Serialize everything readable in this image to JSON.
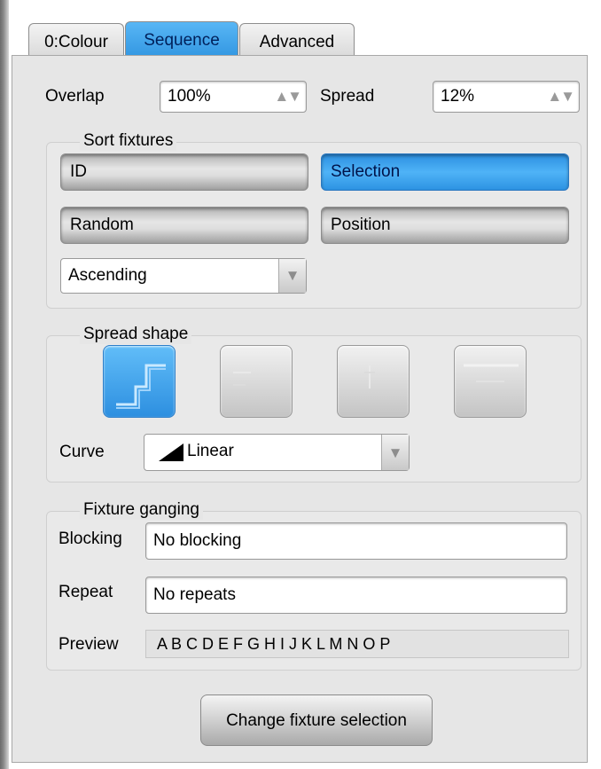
{
  "tabs": [
    {
      "label": "0:Colour",
      "active": false
    },
    {
      "label": "Sequence",
      "active": true
    },
    {
      "label": "Advanced",
      "active": false
    }
  ],
  "overlap": {
    "label": "Overlap",
    "value": "100%"
  },
  "spread": {
    "label": "Spread",
    "value": "12%"
  },
  "spinner_glyph": "▲▼",
  "sort_fixtures": {
    "title": "Sort fixtures",
    "buttons": [
      {
        "label": "ID",
        "selected": false
      },
      {
        "label": "Selection",
        "selected": true
      },
      {
        "label": "Random",
        "selected": false
      },
      {
        "label": "Position",
        "selected": false
      }
    ],
    "order": "Ascending"
  },
  "spread_shape": {
    "title": "Spread shape",
    "shapes": [
      {
        "icon": "step-shape-icon",
        "selected": true
      },
      {
        "icon": "left-line-shape-icon",
        "selected": false
      },
      {
        "icon": "center-line-shape-icon",
        "selected": false
      },
      {
        "icon": "wide-line-shape-icon",
        "selected": false
      }
    ],
    "curve_label": "Curve",
    "curve_value": "Linear",
    "curve_icon": "linear-ramp-icon"
  },
  "fixture_ganging": {
    "title": "Fixture ganging",
    "blocking_label": "Blocking",
    "blocking_value": "No blocking",
    "repeat_label": "Repeat",
    "repeat_value": "No repeats",
    "preview_label": "Preview",
    "preview_value": "A B C D E F G H I J K L M N O P"
  },
  "change_button": "Change fixture selection",
  "colors": {
    "accent": "#3a9fec",
    "panel": "#e6e6e6"
  }
}
